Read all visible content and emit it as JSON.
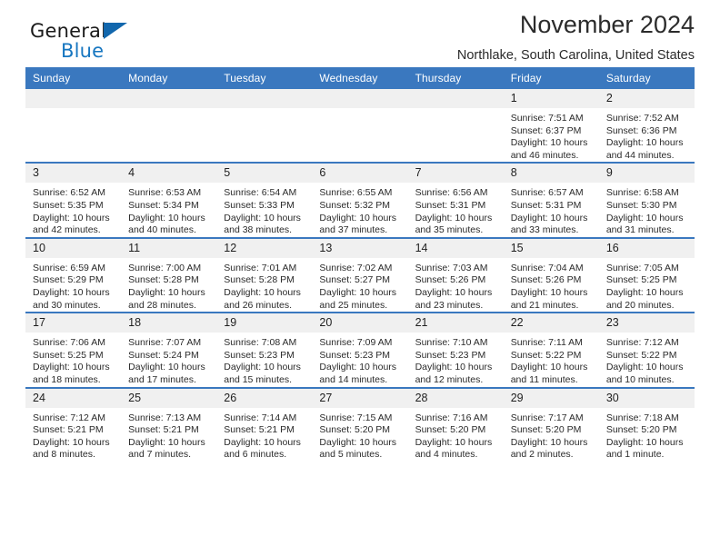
{
  "brand": {
    "line1": "General",
    "line2": "Blue",
    "accent_color": "#1676c0",
    "triangle_color": "#1267ad"
  },
  "header": {
    "title": "November 2024",
    "subtitle": "Northlake, South Carolina, United States",
    "header_bg_color": "#3a78bf",
    "header_text_color": "#ffffff",
    "daynum_bg_color": "#f0f0f0"
  },
  "weekdays": [
    "Sunday",
    "Monday",
    "Tuesday",
    "Wednesday",
    "Thursday",
    "Friday",
    "Saturday"
  ],
  "labels": {
    "sunrise_prefix": "Sunrise:",
    "sunset_prefix": "Sunset:",
    "daylight_prefix": "Daylight:"
  },
  "weeks": [
    [
      {
        "day": "",
        "sunrise": "",
        "sunset": "",
        "daylight": ""
      },
      {
        "day": "",
        "sunrise": "",
        "sunset": "",
        "daylight": ""
      },
      {
        "day": "",
        "sunrise": "",
        "sunset": "",
        "daylight": ""
      },
      {
        "day": "",
        "sunrise": "",
        "sunset": "",
        "daylight": ""
      },
      {
        "day": "",
        "sunrise": "",
        "sunset": "",
        "daylight": ""
      },
      {
        "day": "1",
        "sunrise": "Sunrise: 7:51 AM",
        "sunset": "Sunset: 6:37 PM",
        "daylight": "Daylight: 10 hours and 46 minutes."
      },
      {
        "day": "2",
        "sunrise": "Sunrise: 7:52 AM",
        "sunset": "Sunset: 6:36 PM",
        "daylight": "Daylight: 10 hours and 44 minutes."
      }
    ],
    [
      {
        "day": "3",
        "sunrise": "Sunrise: 6:52 AM",
        "sunset": "Sunset: 5:35 PM",
        "daylight": "Daylight: 10 hours and 42 minutes."
      },
      {
        "day": "4",
        "sunrise": "Sunrise: 6:53 AM",
        "sunset": "Sunset: 5:34 PM",
        "daylight": "Daylight: 10 hours and 40 minutes."
      },
      {
        "day": "5",
        "sunrise": "Sunrise: 6:54 AM",
        "sunset": "Sunset: 5:33 PM",
        "daylight": "Daylight: 10 hours and 38 minutes."
      },
      {
        "day": "6",
        "sunrise": "Sunrise: 6:55 AM",
        "sunset": "Sunset: 5:32 PM",
        "daylight": "Daylight: 10 hours and 37 minutes."
      },
      {
        "day": "7",
        "sunrise": "Sunrise: 6:56 AM",
        "sunset": "Sunset: 5:31 PM",
        "daylight": "Daylight: 10 hours and 35 minutes."
      },
      {
        "day": "8",
        "sunrise": "Sunrise: 6:57 AM",
        "sunset": "Sunset: 5:31 PM",
        "daylight": "Daylight: 10 hours and 33 minutes."
      },
      {
        "day": "9",
        "sunrise": "Sunrise: 6:58 AM",
        "sunset": "Sunset: 5:30 PM",
        "daylight": "Daylight: 10 hours and 31 minutes."
      }
    ],
    [
      {
        "day": "10",
        "sunrise": "Sunrise: 6:59 AM",
        "sunset": "Sunset: 5:29 PM",
        "daylight": "Daylight: 10 hours and 30 minutes."
      },
      {
        "day": "11",
        "sunrise": "Sunrise: 7:00 AM",
        "sunset": "Sunset: 5:28 PM",
        "daylight": "Daylight: 10 hours and 28 minutes."
      },
      {
        "day": "12",
        "sunrise": "Sunrise: 7:01 AM",
        "sunset": "Sunset: 5:28 PM",
        "daylight": "Daylight: 10 hours and 26 minutes."
      },
      {
        "day": "13",
        "sunrise": "Sunrise: 7:02 AM",
        "sunset": "Sunset: 5:27 PM",
        "daylight": "Daylight: 10 hours and 25 minutes."
      },
      {
        "day": "14",
        "sunrise": "Sunrise: 7:03 AM",
        "sunset": "Sunset: 5:26 PM",
        "daylight": "Daylight: 10 hours and 23 minutes."
      },
      {
        "day": "15",
        "sunrise": "Sunrise: 7:04 AM",
        "sunset": "Sunset: 5:26 PM",
        "daylight": "Daylight: 10 hours and 21 minutes."
      },
      {
        "day": "16",
        "sunrise": "Sunrise: 7:05 AM",
        "sunset": "Sunset: 5:25 PM",
        "daylight": "Daylight: 10 hours and 20 minutes."
      }
    ],
    [
      {
        "day": "17",
        "sunrise": "Sunrise: 7:06 AM",
        "sunset": "Sunset: 5:25 PM",
        "daylight": "Daylight: 10 hours and 18 minutes."
      },
      {
        "day": "18",
        "sunrise": "Sunrise: 7:07 AM",
        "sunset": "Sunset: 5:24 PM",
        "daylight": "Daylight: 10 hours and 17 minutes."
      },
      {
        "day": "19",
        "sunrise": "Sunrise: 7:08 AM",
        "sunset": "Sunset: 5:23 PM",
        "daylight": "Daylight: 10 hours and 15 minutes."
      },
      {
        "day": "20",
        "sunrise": "Sunrise: 7:09 AM",
        "sunset": "Sunset: 5:23 PM",
        "daylight": "Daylight: 10 hours and 14 minutes."
      },
      {
        "day": "21",
        "sunrise": "Sunrise: 7:10 AM",
        "sunset": "Sunset: 5:23 PM",
        "daylight": "Daylight: 10 hours and 12 minutes."
      },
      {
        "day": "22",
        "sunrise": "Sunrise: 7:11 AM",
        "sunset": "Sunset: 5:22 PM",
        "daylight": "Daylight: 10 hours and 11 minutes."
      },
      {
        "day": "23",
        "sunrise": "Sunrise: 7:12 AM",
        "sunset": "Sunset: 5:22 PM",
        "daylight": "Daylight: 10 hours and 10 minutes."
      }
    ],
    [
      {
        "day": "24",
        "sunrise": "Sunrise: 7:12 AM",
        "sunset": "Sunset: 5:21 PM",
        "daylight": "Daylight: 10 hours and 8 minutes."
      },
      {
        "day": "25",
        "sunrise": "Sunrise: 7:13 AM",
        "sunset": "Sunset: 5:21 PM",
        "daylight": "Daylight: 10 hours and 7 minutes."
      },
      {
        "day": "26",
        "sunrise": "Sunrise: 7:14 AM",
        "sunset": "Sunset: 5:21 PM",
        "daylight": "Daylight: 10 hours and 6 minutes."
      },
      {
        "day": "27",
        "sunrise": "Sunrise: 7:15 AM",
        "sunset": "Sunset: 5:20 PM",
        "daylight": "Daylight: 10 hours and 5 minutes."
      },
      {
        "day": "28",
        "sunrise": "Sunrise: 7:16 AM",
        "sunset": "Sunset: 5:20 PM",
        "daylight": "Daylight: 10 hours and 4 minutes."
      },
      {
        "day": "29",
        "sunrise": "Sunrise: 7:17 AM",
        "sunset": "Sunset: 5:20 PM",
        "daylight": "Daylight: 10 hours and 2 minutes."
      },
      {
        "day": "30",
        "sunrise": "Sunrise: 7:18 AM",
        "sunset": "Sunset: 5:20 PM",
        "daylight": "Daylight: 10 hours and 1 minute."
      }
    ]
  ]
}
